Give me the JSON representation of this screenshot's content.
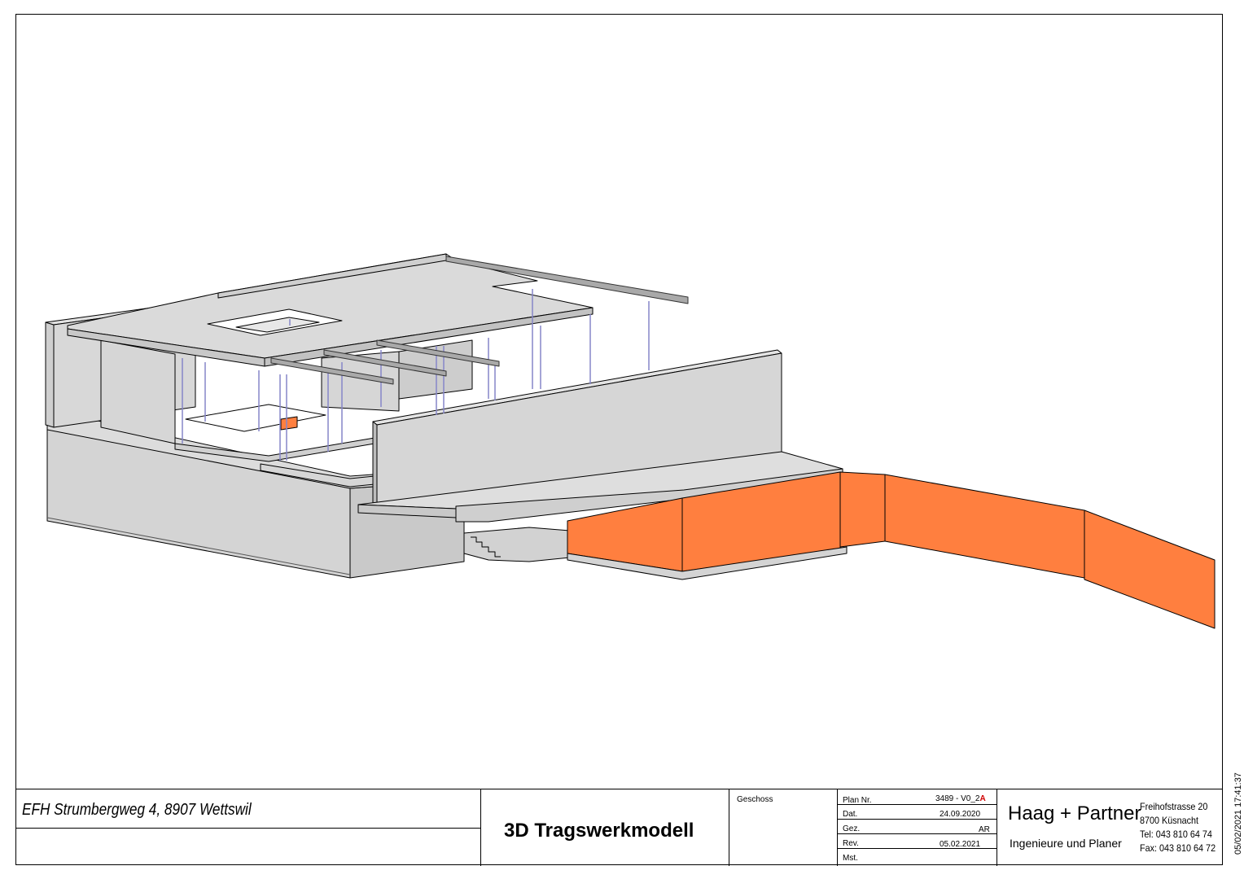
{
  "title_block": {
    "project": "EFH Strumbergweg 4, 8907 Wettswil",
    "drawing_title": "3D Tragswerkmodell",
    "geschoss_label": "Geschoss",
    "geschoss_value": "",
    "plan_nr_label": "Plan Nr.",
    "plan_nr_value": "3489 - V0_2",
    "plan_nr_suffix": "A",
    "dat_label": "Dat.",
    "dat_value": "24.09.2020",
    "gez_label": "Gez.",
    "gez_value": "AR",
    "rev_label": "Rev.",
    "rev_value": "05.02.2021",
    "mst_label": "Mst.",
    "mst_value": ""
  },
  "company": {
    "name": "Haag + Partner",
    "subtitle": "Ingenieure und Planer",
    "street": "Freihofstrasse 20",
    "city": "8700 Küsnacht",
    "tel": "Tel:  043 810 64 74",
    "fax": "Fax: 043 810 64 72"
  },
  "print_stamp": "05/02/2021 17:41:37",
  "colors": {
    "concrete": "#d9d9d9",
    "concrete_dark": "#c8c8c8",
    "retaining_wall": "#ff7f3f",
    "column": "#b9b9ea",
    "line": "#000000"
  }
}
